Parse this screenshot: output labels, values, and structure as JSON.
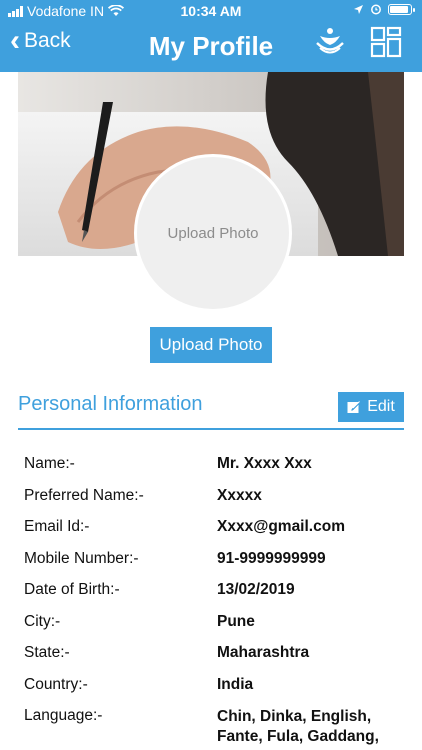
{
  "status_bar": {
    "carrier": "Vodafone IN",
    "time": "10:34 AM"
  },
  "nav": {
    "back_label": "Back",
    "title": "My Profile",
    "icons": [
      "people-logo-icon",
      "grid-icon"
    ]
  },
  "profile": {
    "photo_placeholder": "Upload Photo",
    "upload_button": "Upload Photo"
  },
  "personal_info": {
    "heading": "Personal Information",
    "edit_label": "Edit",
    "fields": [
      {
        "label": "Name:-",
        "value": "Mr. Xxxx Xxx"
      },
      {
        "label": "Preferred Name:-",
        "value": "Xxxxx"
      },
      {
        "label": "Email Id:-",
        "value": "Xxxx@gmail.com"
      },
      {
        "label": "Mobile Number:-",
        "value": "91-9999999999"
      },
      {
        "label": "Date of Birth:-",
        "value": "13/02/2019"
      },
      {
        "label": "City:-",
        "value": "Pune"
      },
      {
        "label": "State:-",
        "value": "Maharashtra"
      },
      {
        "label": "Country:-",
        "value": "India"
      },
      {
        "label": "Language:-",
        "value": "Chin, Dinka, English, Fante, Fula, Gaddang,"
      }
    ]
  },
  "colors": {
    "accent": "#3fa0dd",
    "text": "#111111",
    "placeholder": "#8c8c8c"
  }
}
